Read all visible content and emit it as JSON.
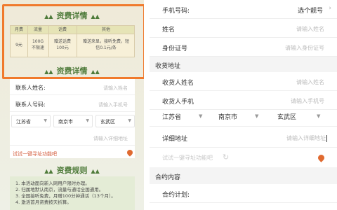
{
  "left": {
    "fee_title": "资费详情",
    "table": {
      "headers": [
        "月费",
        "流量",
        "话费",
        "其他"
      ],
      "row": {
        "monthly": "9元",
        "data": [
          "100G",
          "不限速"
        ],
        "calls": [
          "赠送话费",
          "100元"
        ],
        "other": [
          "赠送来显，接听免费，短",
          "信0.1元/条"
        ]
      }
    },
    "fee_title_2": "资费详情",
    "form": {
      "contact_name_label": "联系人姓名:",
      "contact_name_ph": "请输入姓名",
      "contact_phone_label": "联系人号码:",
      "contact_phone_ph": "请输入手机号",
      "province": "江苏省",
      "city": "南京市",
      "district": "玄武区",
      "address_ph": "请输入详细地址",
      "locate_hint": "试试一键寻址功能吧"
    },
    "rules": {
      "title": "资费规则",
      "items": [
        "1. 本活动面向新入网用户限时办理。",
        "2. 归属地默认南京，流量与通话全国通用。",
        "3. 全国接听免费，月赠100分钟通话（13个月）。",
        "4. 激活首月资费按天折算。"
      ]
    }
  },
  "right": {
    "phone_label": "手机号码:",
    "phone_value": "选个靓号",
    "name_label": "姓名",
    "name_ph": "请输入姓名",
    "id_label": "身份证号",
    "id_ph": "请输入身份证号",
    "address_section": "收货地址",
    "receiver_name_label": "收货人姓名",
    "receiver_name_ph": "请输入姓名",
    "receiver_phone_label": "收货人手机",
    "receiver_phone_ph": "请输入手机号",
    "province": "江苏省",
    "city": "南京市",
    "district": "玄武区",
    "detail_label": "详细地址",
    "detail_ph": "请输入详细地址",
    "locate_hint": "试试一键寻址功能吧",
    "contract_section": "合约内容",
    "contract_plan_label": "合约计划:"
  },
  "colors": {
    "highlight": "#f07a2c",
    "green_title": "#4e7b3a",
    "pin": "#e06a30"
  }
}
